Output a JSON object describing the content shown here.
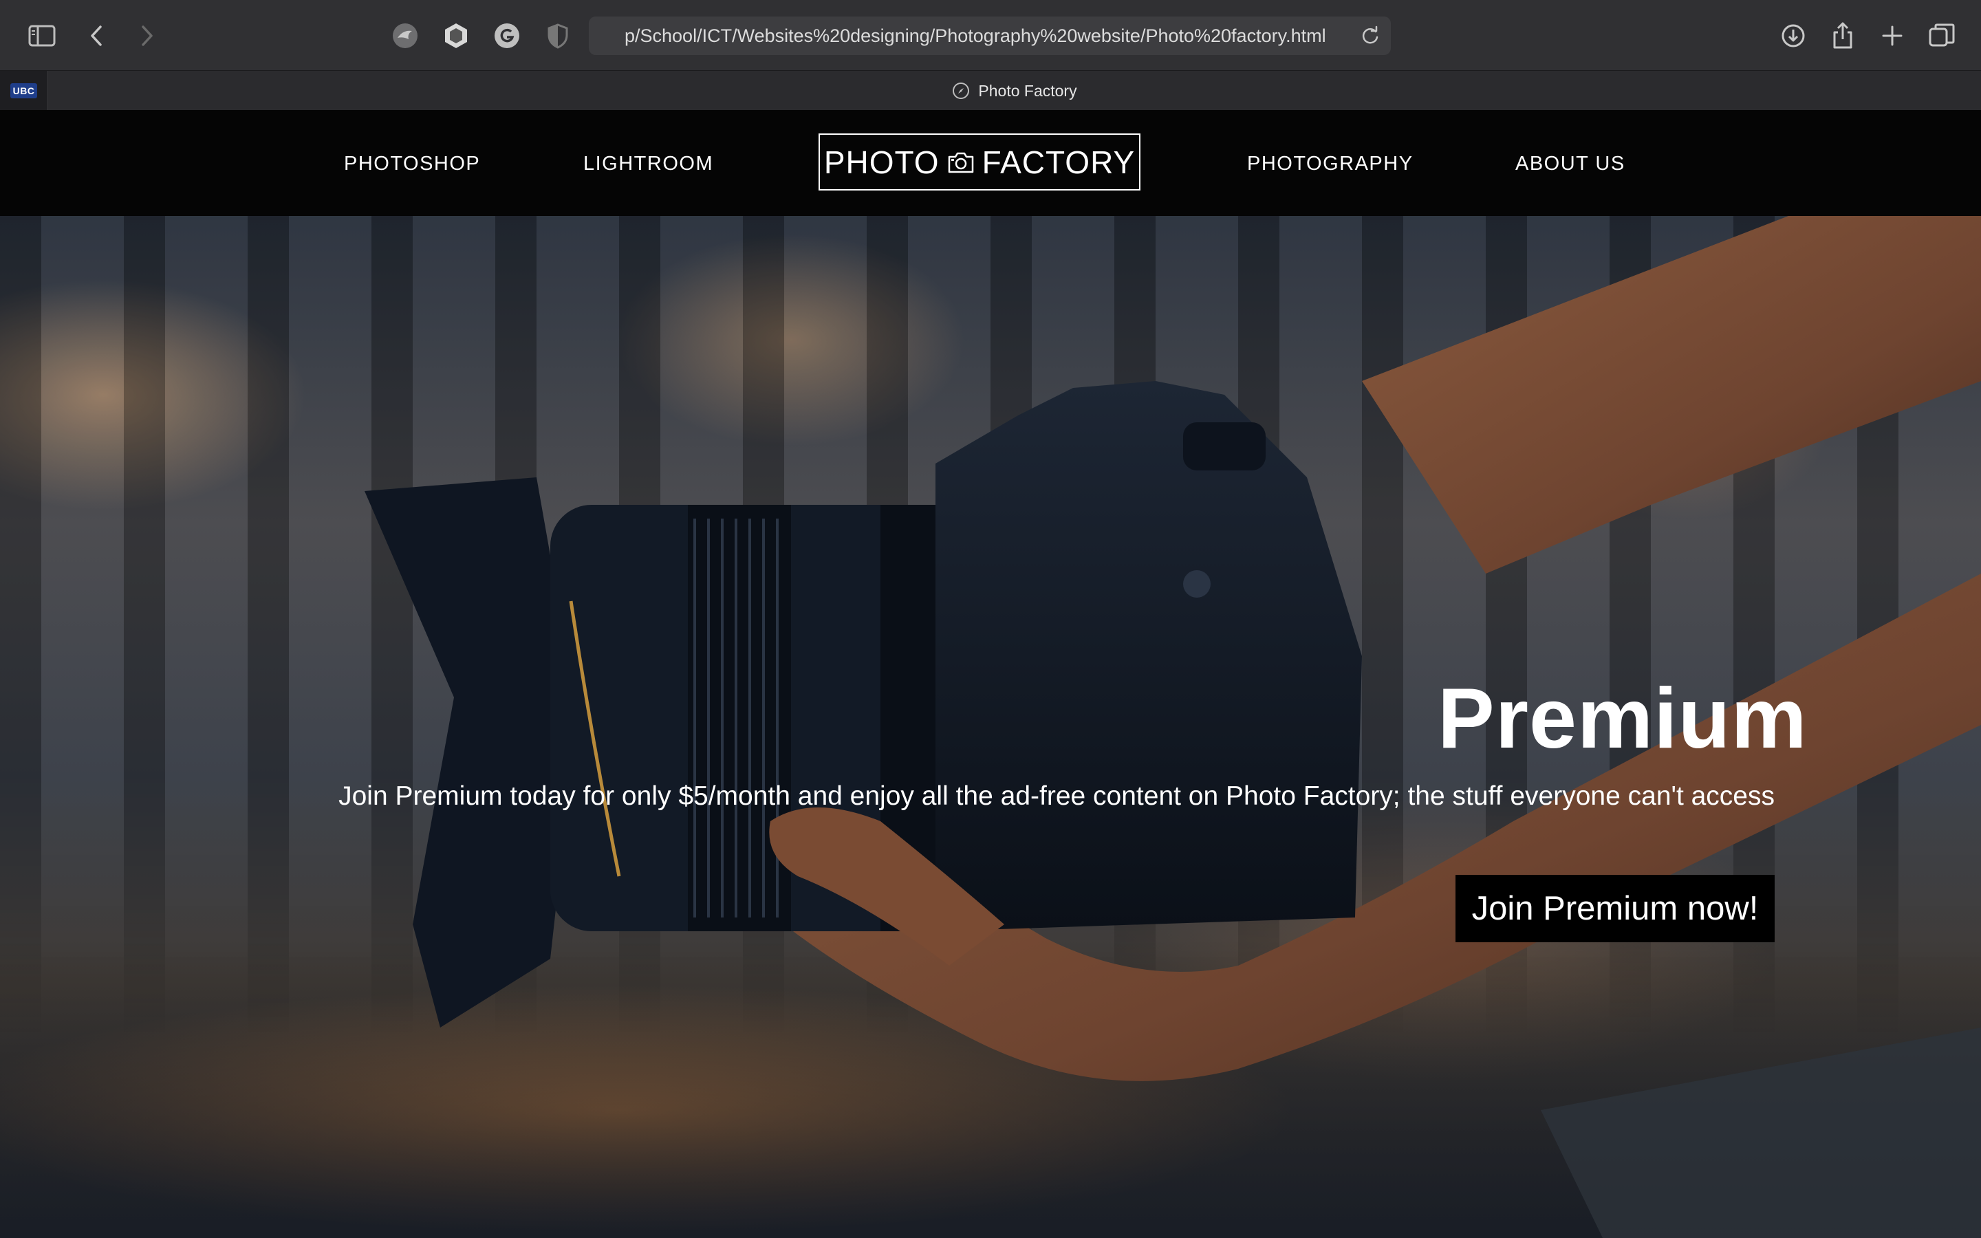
{
  "browser": {
    "url": "p/School/ICT/Websites%20designing/Photography%20website/Photo%20factory.html",
    "pinned_tab_label": "UBC",
    "active_tab_title": "Photo Factory"
  },
  "nav": {
    "links": [
      "PHOTOSHOP",
      "LIGHTROOM",
      "PHOTOGRAPHY",
      "ABOUT US"
    ],
    "logo_left": "PHOTO",
    "logo_right": "FACTORY"
  },
  "hero": {
    "title": "Premium",
    "subtitle": "Join Premium today for only $5/month and enjoy all the ad-free content on Photo Factory; the stuff everyone can't access",
    "cta_label": "Join Premium now!"
  },
  "icons": {
    "toolbar": [
      "sidebar-icon",
      "back-icon",
      "forward-icon",
      "download-icon",
      "share-icon",
      "new-tab-icon",
      "tab-overview-icon"
    ],
    "extensions": [
      "extension-bird-icon",
      "extension-hex-icon",
      "grammarly-icon",
      "privacy-shield-icon"
    ]
  }
}
